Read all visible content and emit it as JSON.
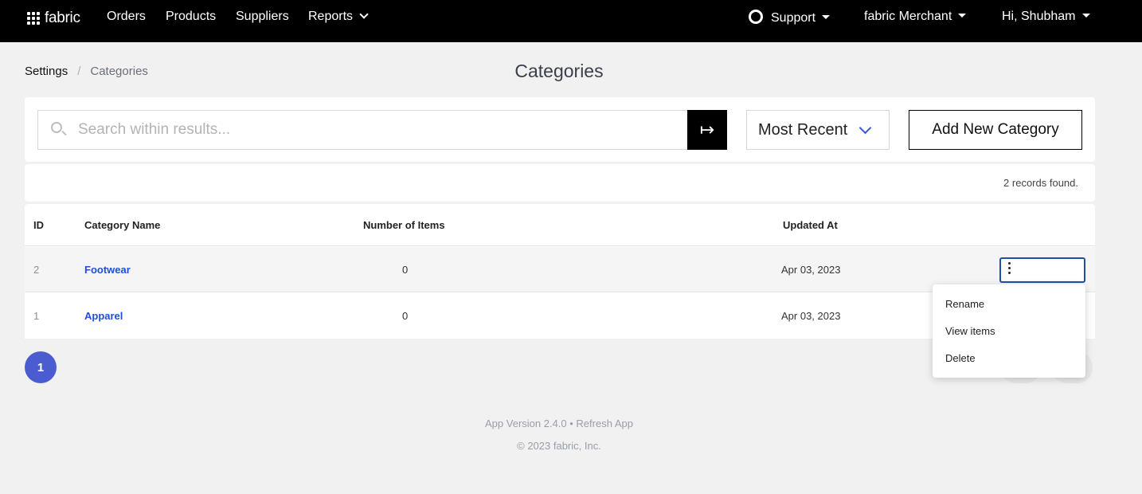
{
  "nav": {
    "logo_text": "fabric",
    "orders": "Orders",
    "products": "Products",
    "suppliers": "Suppliers",
    "reports": "Reports",
    "support": "Support",
    "merchant": "fabric Merchant",
    "user": "Hi, Shubham"
  },
  "breadcrumb": {
    "home": "Settings",
    "separator": "/",
    "current": "Categories"
  },
  "page": {
    "title": "Categories"
  },
  "search": {
    "placeholder": "Search within results...",
    "go_icon": "↦"
  },
  "sort": {
    "selected": "Most Recent"
  },
  "actions": {
    "add": "Add New Category"
  },
  "records": {
    "text": "2 records found."
  },
  "table": {
    "headers": {
      "id": "ID",
      "name": "Category Name",
      "items": "Number of Items",
      "updated": "Updated At"
    },
    "rows": [
      {
        "id": "2",
        "name": "Footwear",
        "items": "0",
        "updated": "Apr 03, 2023"
      },
      {
        "id": "1",
        "name": "Apparel",
        "items": "0",
        "updated": "Apr 03, 2023"
      }
    ]
  },
  "menu": {
    "rename": "Rename",
    "view": "View items",
    "delete": "Delete"
  },
  "pagination": {
    "current": "1"
  },
  "footer": {
    "version": "App Version 2.4.0 • Refresh App",
    "copyright": "© 2023 fabric, Inc."
  },
  "colors": {
    "accent": "#4b5bd0",
    "link": "#1f4fd8",
    "nav_bg": "#000000"
  }
}
